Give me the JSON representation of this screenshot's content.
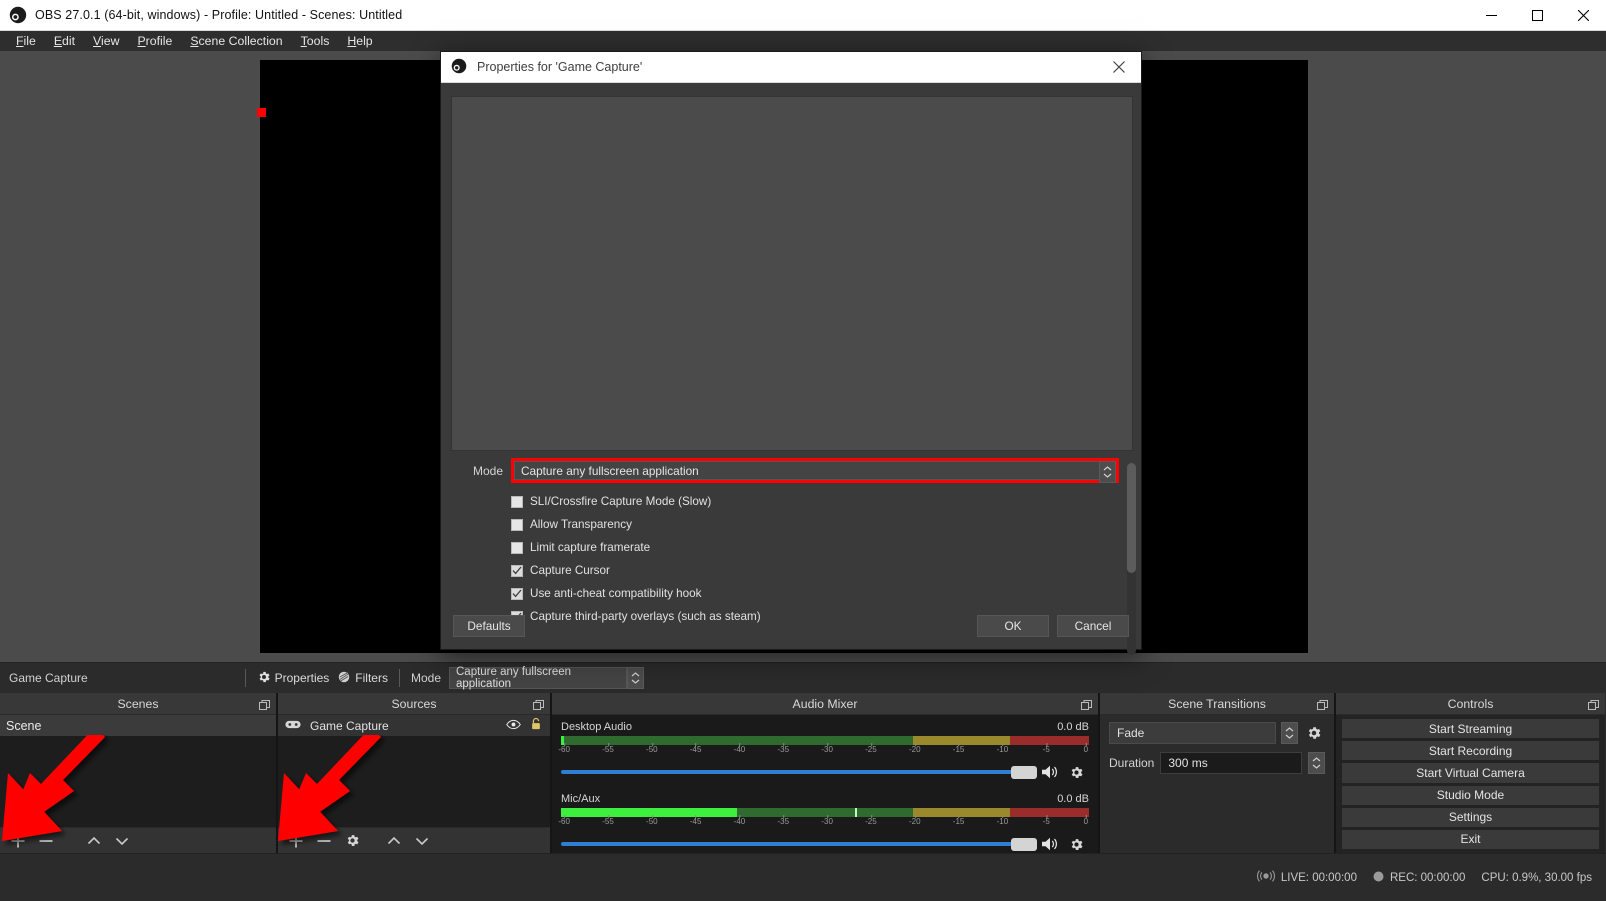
{
  "window": {
    "title": "OBS 27.0.1 (64-bit, windows) - Profile: Untitled - Scenes: Untitled",
    "minimize_label": "Minimize",
    "maximize_label": "Maximize",
    "close_label": "Close"
  },
  "menubar": {
    "items": [
      {
        "label": "File",
        "accel": "F"
      },
      {
        "label": "Edit",
        "accel": "E"
      },
      {
        "label": "View",
        "accel": "V"
      },
      {
        "label": "Profile",
        "accel": "P"
      },
      {
        "label": "Scene Collection",
        "accel": "S"
      },
      {
        "label": "Tools",
        "accel": "T"
      },
      {
        "label": "Help",
        "accel": "H"
      }
    ]
  },
  "source_toolbar": {
    "source_name": "Game Capture",
    "properties_label": "Properties",
    "filters_label": "Filters",
    "mode_label": "Mode",
    "mode_value": "Capture any fullscreen application"
  },
  "docks": {
    "scenes": {
      "title": "Scenes",
      "items": [
        "Scene"
      ],
      "add_label": "Add Scene",
      "remove_label": "Remove Scene",
      "up_label": "Move Scene Up",
      "down_label": "Move Scene Down"
    },
    "sources": {
      "title": "Sources",
      "items": [
        {
          "name": "Game Capture",
          "visible": true,
          "locked": false
        }
      ],
      "add_label": "Add Source",
      "remove_label": "Remove Source",
      "properties_label": "Source Properties",
      "up_label": "Move Source Up",
      "down_label": "Move Source Down"
    },
    "audio_mixer": {
      "title": "Audio Mixer",
      "tracks": [
        {
          "name": "Desktop Audio",
          "db": "0.0 dB",
          "level_db": -60.0,
          "peak_db": -60.0,
          "fader_pct": 100
        },
        {
          "name": "Mic/Aux",
          "db": "0.0 dB",
          "level_db": -40.0,
          "peak_db": -26.5,
          "fader_pct": 100
        }
      ],
      "scale_ticks": [
        "-60",
        "-55",
        "-50",
        "-45",
        "-40",
        "-35",
        "-30",
        "-25",
        "-20",
        "-15",
        "-10",
        "-5",
        "0"
      ]
    },
    "scene_transitions": {
      "title": "Scene Transitions",
      "transition_value": "Fade",
      "duration_label": "Duration",
      "duration_value": "300 ms"
    },
    "controls": {
      "title": "Controls",
      "buttons": [
        "Start Streaming",
        "Start Recording",
        "Start Virtual Camera",
        "Studio Mode",
        "Settings",
        "Exit"
      ]
    }
  },
  "statusbar": {
    "live_label": "LIVE: 00:00:00",
    "rec_label": "REC: 00:00:00",
    "cpu_label": "CPU: 0.9%, 30.00 fps"
  },
  "dialog": {
    "title": "Properties for 'Game Capture'",
    "mode_label": "Mode",
    "mode_value": "Capture any fullscreen application",
    "checkboxes": [
      {
        "label": "SLI/Crossfire Capture Mode (Slow)",
        "checked": false
      },
      {
        "label": "Allow Transparency",
        "checked": false
      },
      {
        "label": "Limit capture framerate",
        "checked": false
      },
      {
        "label": "Capture Cursor",
        "checked": true
      },
      {
        "label": "Use anti-cheat compatibility hook",
        "checked": true
      },
      {
        "label": "Capture third-party overlays (such as steam)",
        "checked": true
      }
    ],
    "defaults_label": "Defaults",
    "ok_label": "OK",
    "cancel_label": "Cancel"
  },
  "annotations": {
    "highlight_color": "#ff0000",
    "arrow_color": "#ff0000",
    "arrows": [
      {
        "target": "scenes-add-button"
      },
      {
        "target": "sources-add-button"
      }
    ]
  }
}
